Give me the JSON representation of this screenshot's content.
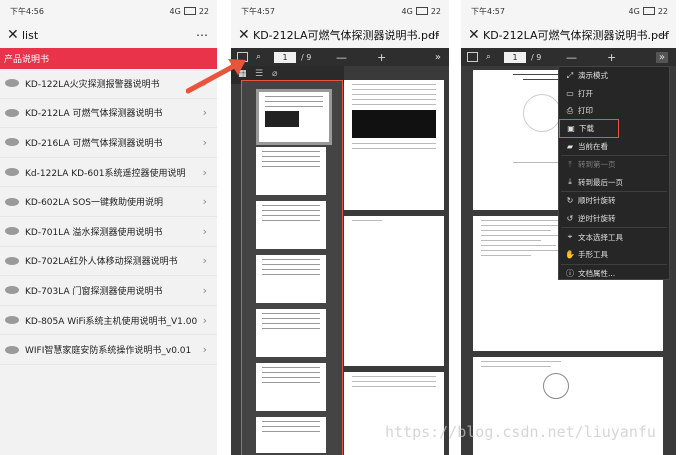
{
  "phone1": {
    "status": {
      "time": "下午4:56",
      "network": "4G",
      "battery": "22"
    },
    "appbar": {
      "title": "list",
      "more": "⋯"
    },
    "section_header": "产品说明书",
    "items": [
      "KD-122LA火灾探测报警器说明书",
      "KD-212LA 可燃气体探测器说明书",
      "KD-216LA 可燃气体探测器说明书",
      "Kd-122LA KD-601系统遥控器使用说明",
      "KD-602LA SOS一键救助使用说明",
      "KD-701LA 溢水探测器使用说明书",
      "KD-702LA红外人体移动探测器说明书",
      "KD-703LA 门窗探测器使用说明书",
      "KD-805A WiFi系统主机使用说明书_V1.00",
      "WIFI智慧家庭安防系统操作说明书_v0.01"
    ]
  },
  "phone2": {
    "status": {
      "time": "下午4:57",
      "network": "4G",
      "battery": "22"
    },
    "appbar": {
      "title": "KD-212LA可燃气体探测器说明书.pdf",
      "more": "⋯"
    },
    "toolbar": {
      "page": "1",
      "total": "/ 9"
    }
  },
  "phone3": {
    "status": {
      "time": "下午4:57",
      "network": "4G",
      "battery": "22"
    },
    "appbar": {
      "title": "KD-212LA可燃气体探测器说明书.pdf",
      "more": "⋯"
    },
    "toolbar": {
      "page": "1",
      "total": "/ 9"
    },
    "menu": [
      {
        "icon": "presentation-icon",
        "glyph": "⤢",
        "label": "演示模式",
        "disabled": false
      },
      {
        "icon": "open-icon",
        "glyph": "▭",
        "label": "打开",
        "disabled": false
      },
      {
        "icon": "print-icon",
        "glyph": "⎙",
        "label": "打印",
        "disabled": false
      },
      {
        "icon": "download-icon",
        "glyph": "▣",
        "label": "下载",
        "disabled": false,
        "selected": true
      },
      {
        "icon": "bookmark-icon",
        "glyph": "▰",
        "label": "当前在看",
        "disabled": false
      },
      {
        "icon": "first-page-icon",
        "glyph": "⤒",
        "label": "转到第一页",
        "disabled": true
      },
      {
        "icon": "last-page-icon",
        "glyph": "⤓",
        "label": "转到最后一页",
        "disabled": false
      },
      {
        "icon": "rotate-cw-icon",
        "glyph": "↻",
        "label": "顺时针旋转",
        "disabled": false
      },
      {
        "icon": "rotate-ccw-icon",
        "glyph": "↺",
        "label": "逆时针旋转",
        "disabled": false
      },
      {
        "icon": "text-select-icon",
        "glyph": "⌖",
        "label": "文本选择工具",
        "disabled": false
      },
      {
        "icon": "hand-tool-icon",
        "glyph": "✋",
        "label": "手形工具",
        "disabled": false
      },
      {
        "icon": "properties-icon",
        "glyph": "ⓘ",
        "label": "文档属性...",
        "disabled": false
      }
    ]
  },
  "watermark": "https://blog.csdn.net/liuyanfu",
  "colors": {
    "accent": "#e8334a",
    "highlight": "#e8543c"
  }
}
